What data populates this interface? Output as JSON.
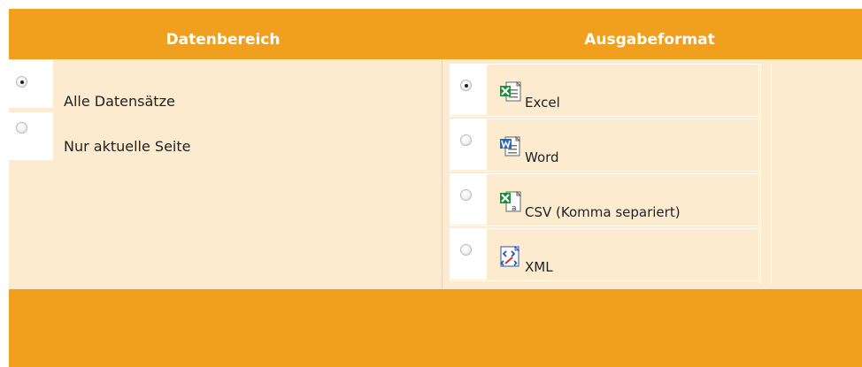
{
  "columns": {
    "data_range_title": "Datenbereich",
    "output_format_title": "Ausgabeformat"
  },
  "data_range_options": [
    {
      "label": "Alle Datensätze",
      "checked": true
    },
    {
      "label": "Nur aktuelle Seite",
      "checked": false
    }
  ],
  "output_formats": [
    {
      "label": "Excel",
      "icon": "excel-file-icon",
      "checked": true
    },
    {
      "label": "Word",
      "icon": "word-file-icon",
      "checked": false
    },
    {
      "label": "CSV (Komma separiert)",
      "icon": "csv-file-icon",
      "checked": false
    },
    {
      "label": "XML",
      "icon": "xml-file-icon",
      "checked": false
    }
  ],
  "colors": {
    "header": "#f19f1e",
    "panel": "#fdebcf",
    "text": "#222222"
  }
}
